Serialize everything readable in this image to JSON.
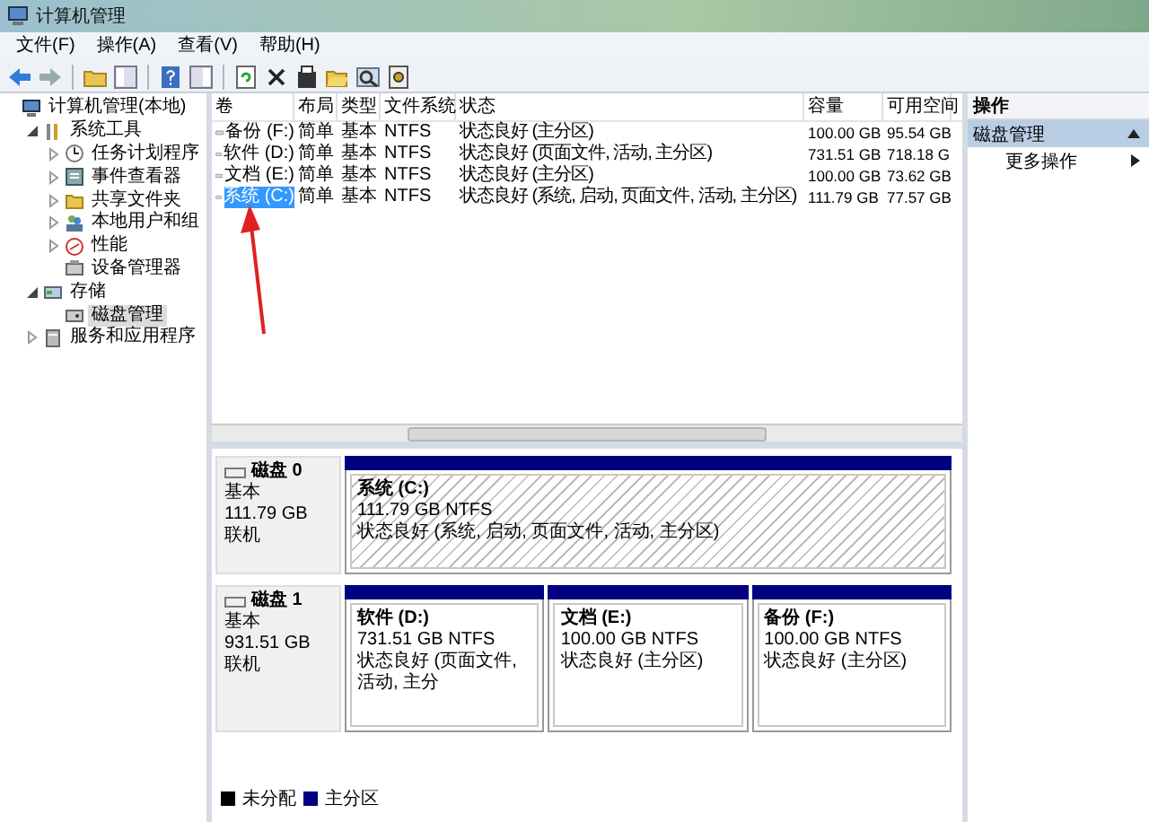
{
  "window": {
    "title": "计算机管理"
  },
  "menu": [
    "文件(F)",
    "操作(A)",
    "查看(V)",
    "帮助(H)"
  ],
  "tree": [
    {
      "label": "计算机管理(本地)",
      "selected": false,
      "children": [
        {
          "label": "系统工具",
          "expanded": true,
          "selected": false,
          "children": [
            {
              "label": "任务计划程序",
              "expanded": false,
              "selected": false
            },
            {
              "label": "事件查看器",
              "expanded": false,
              "selected": false
            },
            {
              "label": "共享文件夹",
              "expanded": false,
              "selected": false
            },
            {
              "label": "本地用户和组",
              "expanded": false,
              "selected": false
            },
            {
              "label": "性能",
              "expanded": false,
              "selected": false
            },
            {
              "label": "设备管理器",
              "selected": false
            }
          ]
        },
        {
          "label": "存储",
          "expanded": true,
          "selected": false,
          "children": [
            {
              "label": "磁盘管理",
              "selected": true
            }
          ]
        },
        {
          "label": "服务和应用程序",
          "expanded": false,
          "selected": false
        }
      ]
    }
  ],
  "volume_table": {
    "columns": [
      "卷",
      "布局",
      "类型",
      "文件系统",
      "状态",
      "容量",
      "可用空间"
    ],
    "rows": [
      {
        "cells": [
          "备份 (F:)",
          "简单",
          "基本",
          "NTFS",
          "状态良好 (主分区)",
          "100.00 GB",
          "95.54 GB"
        ],
        "selected": false
      },
      {
        "cells": [
          "软件 (D:)",
          "简单",
          "基本",
          "NTFS",
          "状态良好 (页面文件, 活动, 主分区)",
          "731.51 GB",
          "718.18 G"
        ],
        "selected": false
      },
      {
        "cells": [
          "文档 (E:)",
          "简单",
          "基本",
          "NTFS",
          "状态良好 (主分区)",
          "100.00 GB",
          "73.62 GB"
        ],
        "selected": false
      },
      {
        "cells": [
          "系统 (C:)",
          "简单",
          "基本",
          "NTFS",
          "状态良好 (系统, 启动, 页面文件, 活动, 主分区)",
          "111.79 GB",
          "77.57 GB"
        ],
        "selected": true
      }
    ]
  },
  "disks": [
    {
      "name": "磁盘 0",
      "type": "基本",
      "size": "111.79 GB",
      "state": "联机",
      "partitions": [
        {
          "title": "系统  (C:)",
          "size": "111.79 GB NTFS",
          "status": "状态良好 (系统, 启动, 页面文件, 活动, 主分区)",
          "selected": true
        }
      ]
    },
    {
      "name": "磁盘 1",
      "type": "基本",
      "size": "931.51 GB",
      "state": "联机",
      "partitions": [
        {
          "title": "软件  (D:)",
          "size": "731.51 GB NTFS",
          "status": "状态良好 (页面文件, 活动, 主分",
          "selected": false
        },
        {
          "title": "文档  (E:)",
          "size": "100.00 GB NTFS",
          "status": "状态良好 (主分区)",
          "selected": false
        },
        {
          "title": "备份  (F:)",
          "size": "100.00 GB NTFS",
          "status": "状态良好 (主分区)",
          "selected": false
        }
      ]
    }
  ],
  "legend": [
    {
      "label": "未分配",
      "color": "#000000"
    },
    {
      "label": "主分区",
      "color": "#000080"
    }
  ],
  "actions": {
    "title": "操作",
    "section": {
      "label": "磁盘管理",
      "expanded": true
    },
    "items": [
      "更多操作"
    ]
  }
}
